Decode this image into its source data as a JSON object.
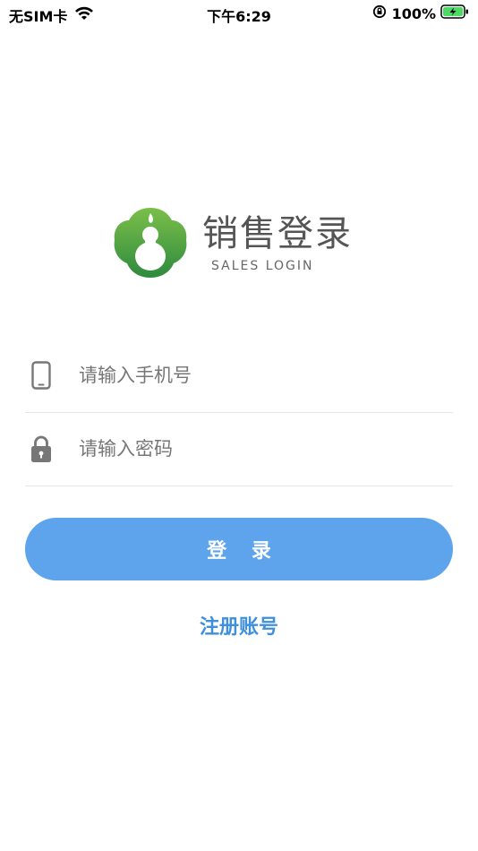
{
  "status_bar": {
    "carrier": "无SIM卡",
    "time": "下午6:29",
    "battery_percent": "100%"
  },
  "logo": {
    "title": "销售登录",
    "subtitle": "SALES LOGIN"
  },
  "form": {
    "phone_placeholder": "请输入手机号",
    "phone_value": "",
    "password_placeholder": "请输入密码",
    "password_value": "",
    "login_label": "登 录",
    "register_label": "注册账号"
  },
  "colors": {
    "primary_button": "#5ea4ec",
    "link": "#3f8fdc",
    "logo_green": "#4a9a3f"
  }
}
